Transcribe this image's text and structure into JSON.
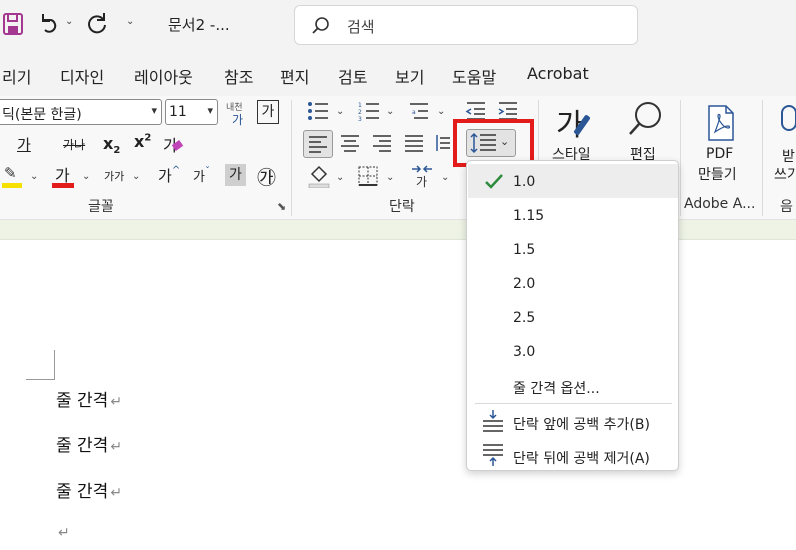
{
  "titlebar": {
    "doc_title": "문서2  -...",
    "search_placeholder": "검색",
    "undo_arrow": "⌄",
    "customize_arrow": "⌄"
  },
  "menu": {
    "items": [
      "리기",
      "디자인",
      "레이아웃",
      "참조",
      "편지",
      "검토",
      "보기",
      "도움말",
      "Acrobat"
    ]
  },
  "font_group": {
    "font_name": "딕(본문 한글)",
    "font_size": "11",
    "phonetic_label": "내천",
    "char_border_label": "가",
    "label": "글꼴",
    "underline_char": "가",
    "strike_char": "가나",
    "sub_label": "x",
    "sub_mark": "2",
    "sup_label": "x",
    "sup_mark": "2",
    "clear_char": "가",
    "highlight_char": "가",
    "font_color_char": "가",
    "case_char": "가가",
    "grow_char": "가",
    "shrink_char": "가",
    "shade_char": "가",
    "enclose_char": "㉮"
  },
  "paragraph_group": {
    "label": "단락"
  },
  "styles_group": {
    "big_char": "가",
    "label": "스타일"
  },
  "edit_group": {
    "label": "편집"
  },
  "adobe_group": {
    "pdf_line1": "PDF",
    "pdf_line2": "만들기",
    "label": "Adobe A..."
  },
  "dictate_group": {
    "line1": "받",
    "line2": "쓰기",
    "label": "음"
  },
  "document": {
    "lines": [
      "줄 간격",
      "줄 간격",
      "줄 간격",
      ""
    ],
    "para_mark": "↵"
  },
  "line_spacing_menu": {
    "options": [
      "1.0",
      "1.15",
      "1.5",
      "2.0",
      "2.5",
      "3.0"
    ],
    "selected": "1.0",
    "options_label": "줄 간격 옵션...",
    "add_before_label": "단락 앞에 공백 추가(B)",
    "remove_after_label": "단락 뒤에 공백 제거(A)"
  },
  "colors": {
    "highlight_red": "#e31b1b",
    "check_green": "#2e8b3b",
    "icon_blue": "#2b5797",
    "highlight_yellow": "#f5e000",
    "font_red": "#e31b1b",
    "word_purple": "#a4378f"
  }
}
